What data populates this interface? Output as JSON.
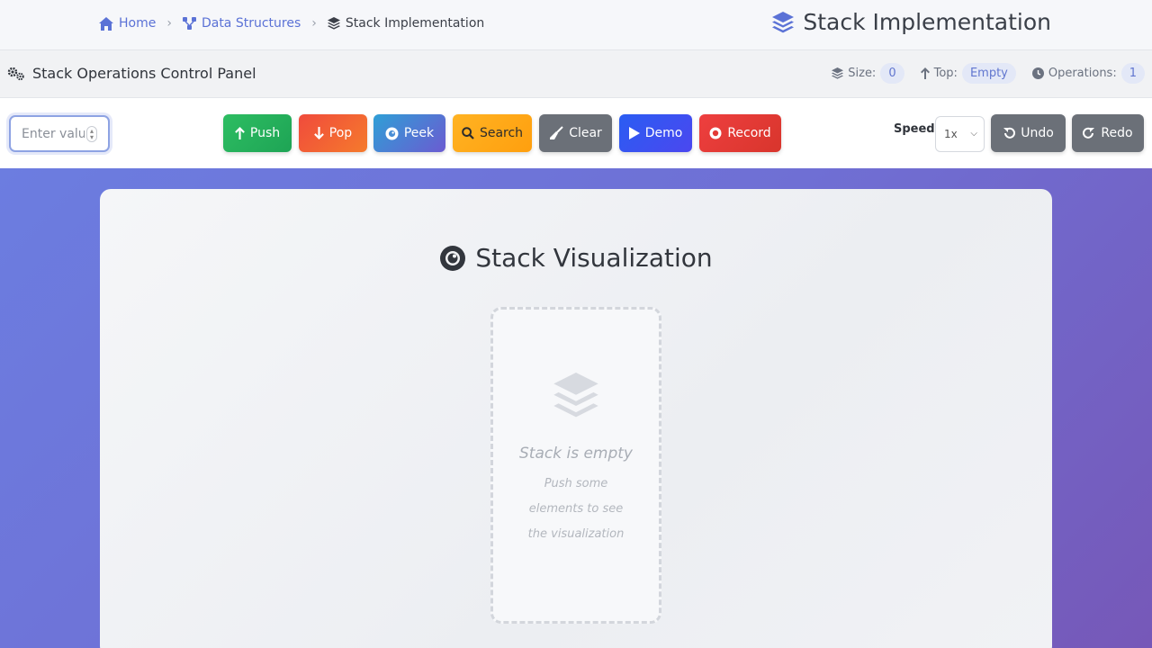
{
  "breadcrumb": {
    "home": "Home",
    "section": "Data Structures",
    "current": "Stack Implementation"
  },
  "app": {
    "title": "Stack Implementation"
  },
  "panel": {
    "title": "Stack Operations Control Panel",
    "stats": {
      "size_label": "Size:",
      "size_value": "0",
      "top_label": "Top:",
      "top_value": "Empty",
      "ops_label": "Operations:",
      "ops_value": "1"
    }
  },
  "toolbar": {
    "value_placeholder": "Enter value",
    "push": "Push",
    "pop": "Pop",
    "peek": "Peek",
    "search": "Search",
    "clear": "Clear",
    "demo": "Demo",
    "record": "Record",
    "speed_label": "Speed:",
    "speed_value": "1x",
    "undo": "Undo",
    "redo": "Redo"
  },
  "visualization": {
    "title": "Stack Visualization",
    "empty_title": "Stack is empty",
    "empty_subtitle": "Push some elements to see the visualization"
  },
  "colors": {
    "accent": "#5b72d6",
    "push": "#22ad5a",
    "pop": "#f2583a",
    "peek": "#3f8bd6",
    "search": "#ffa917",
    "demo": "#3552f0",
    "record": "#e23a36",
    "neutral": "#6b7078"
  }
}
